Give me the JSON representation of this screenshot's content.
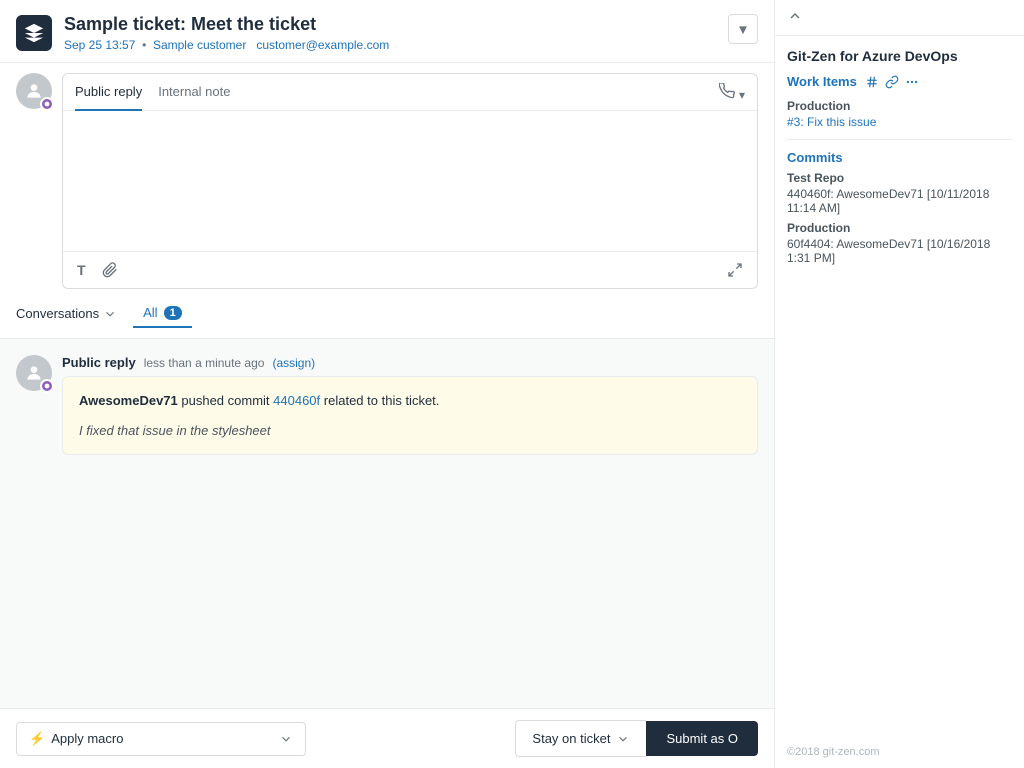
{
  "header": {
    "logo_alt": "Logo",
    "ticket_title": "Sample ticket: Meet the ticket",
    "ticket_date": "Sep 25 13:57",
    "customer_name": "Sample customer",
    "customer_email": "customer@example.com",
    "chevron_label": "▼"
  },
  "reply": {
    "tab_public": "Public reply",
    "tab_internal": "Internal note",
    "placeholder": "",
    "toolbar_text": "T",
    "toolbar_attach": "📎",
    "toolbar_expand": "⊞"
  },
  "conversations": {
    "label": "Conversations",
    "tabs": [
      {
        "label": "All",
        "count": "1",
        "active": true
      }
    ]
  },
  "feed": [
    {
      "type": "public_reply",
      "label": "Public reply",
      "time": "less than a minute ago",
      "assign_label": "(assign)",
      "author": "AwesomeDev71",
      "action": "pushed commit",
      "commit_link": "440460f",
      "action_suffix": "related to this ticket.",
      "commit_msg": "I fixed that issue in the stylesheet"
    }
  ],
  "right_panel": {
    "title": "Git-Zen for Azure DevOps",
    "work_items_label": "Work Items",
    "work_items_sub1": "Production",
    "work_items_sub1_item": "#3: Fix this issue",
    "commits_label": "Commits",
    "commits_repo1": "Test Repo",
    "commits_repo1_detail": "440460f: AwesomeDev71 [10/11/2018 11:14 AM]",
    "commits_repo2": "Production",
    "commits_repo2_detail": "60f4404: AwesomeDev71 [10/16/2018 1:31 PM]",
    "footer": "©2018 git-zen.com"
  },
  "bottom": {
    "macro_icon": "⚡",
    "macro_label": "Apply macro",
    "macro_chevron": "▾",
    "stay_label": "Stay on ticket",
    "stay_chevron": "▾",
    "submit_label": "Submit as O"
  }
}
